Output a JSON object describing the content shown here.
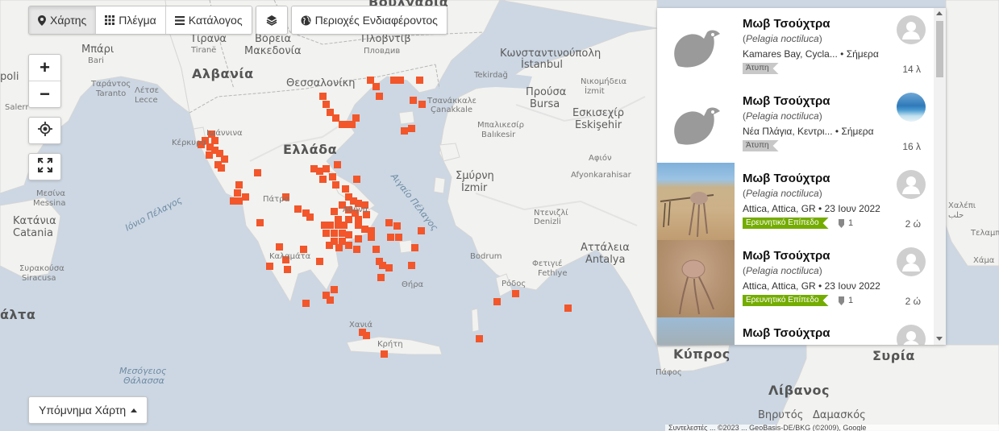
{
  "tabs": {
    "map": "Χάρτης",
    "grid": "Πλέγμα",
    "list": "Κατάλογος",
    "areas": "Περιοχές Ενδιαφέροντος"
  },
  "controls": {
    "zoom_in": "+",
    "zoom_out": "−"
  },
  "legend_label": "Υπόμνημα Χάρτη",
  "map_labels": {
    "bulgaria": "Βουλγαρία",
    "tirana": "Τίρανα",
    "tirane": "Tiranë",
    "albania": "Αλβανία",
    "north_macedonia_1": "Βόρεια",
    "north_macedonia_2": "Μακεδονία",
    "plovdiv_gr": "Πλοβντίβ",
    "plovdiv": "Пловдив",
    "istanbul_gr": "Κωνσταντινούπολη",
    "istanbul": "İstanbul",
    "bari_gr": "Μπάρι",
    "bari": "Bari",
    "polis": "poli",
    "taranto_gr": "Ταράντος",
    "taranto": "Taranto",
    "lecce_gr": "Λέτσε",
    "lecce": "Lecce",
    "salerno": "Salerr",
    "thessaloniki": "Θεσσαλονίκη",
    "tekirdag": "Tekirdağ",
    "nikomedia": "Νικομήδεια",
    "izmit": "İzmit",
    "prousa": "Προύσα",
    "bursa": "Bursa",
    "eskisehir_gr": "Εσκισεχίρ",
    "eskisehir": "Eskişehir",
    "canakkale_gr": "Τσανάκκαλε",
    "canakkale": "Çanakkale",
    "ioannina": "Ιωάννινα",
    "kerkyra": "Κέρκυρα",
    "ellada": "Ελλάδα",
    "mpalikesir": "Μπαλικεσίρ",
    "balikesir": "Balıkesir",
    "afion": "Αφιόν",
    "afyon": "Afyonkarahisar",
    "smyrni": "Σμύρνη",
    "izmir": "İzmir",
    "ionian_sea": "Ιόνιο Πέλαγος",
    "aegean_sea": "Αιγαίο Πέλαγος",
    "messina_gr": "Μεσίνα",
    "messina": "Messina",
    "katania_gr": "Κατάνια",
    "catania": "Catania",
    "patra": "Πάτρα",
    "athina": "Αθήνα",
    "kalamata": "Καλαμάτα",
    "syrakousa": "Συρακούσα",
    "siracusa": "Siracusa",
    "malta": "άλτα",
    "denizli_gr": "Ντενιζλί",
    "denizli": "Denizli",
    "attaleia": "Αττάλεια",
    "antalya": "Antalya",
    "bodrum": "Bodrum",
    "fethiye_gr": "Φετιγιέ",
    "fethiye": "Fethiye",
    "rodos": "Ρόδος",
    "thira": "Θήρα",
    "chania": "Χανιά",
    "kriti": "Κρήτη",
    "mediterranean_1": "Μεσόγειος",
    "mediterranean_2": "Θάλασσα",
    "kypros": "Κύπρος",
    "pafos": "Πάφος",
    "syria": "Συρία",
    "livanos": "Λίβανος",
    "beirut": "Βηρυτός",
    "damaskos": "Δαμασκός",
    "halep": "Χαλέπι",
    "halab": "حلب",
    "teleboos": "Τελαμπούς",
    "hama": "Χάμα"
  },
  "observations": [
    {
      "name": "Μωβ Τσούχτρα",
      "scientific": "Pelagia noctiluca",
      "place": "Kamares Bay, Cycla...",
      "date": "Σήμερα",
      "quality": "Άτυπη",
      "quality_type": "casual",
      "ids": "",
      "time": "14 λ",
      "photo": "placeholder",
      "avatar": "default"
    },
    {
      "name": "Μωβ Τσούχτρα",
      "scientific": "Pelagia noctiluca",
      "place": "Νέα Πλάγια, Κεντρι...",
      "date": "Σήμερα",
      "quality": "Άτυπη",
      "quality_type": "casual",
      "ids": "",
      "time": "16 λ",
      "photo": "placeholder",
      "avatar": "sea-photo"
    },
    {
      "name": "Μωβ Τσούχτρα",
      "scientific": "Pelagia noctiluca",
      "place": "Attica, Attica, GR",
      "date": "23 Ιουν 2022",
      "quality": "Ερευνητικό Επίπεδο",
      "quality_type": "research",
      "ids": "1",
      "time": "2 ώ",
      "photo": "beach-jellyfish-stick",
      "avatar": "default"
    },
    {
      "name": "Μωβ Τσούχτρα",
      "scientific": "Pelagia noctiluca",
      "place": "Attica, Attica, GR",
      "date": "23 Ιουν 2022",
      "quality": "Ερευνητικό Επίπεδο",
      "quality_type": "research",
      "ids": "1",
      "time": "2 ώ",
      "photo": "beach-jellyfish-sand",
      "avatar": "default"
    },
    {
      "name": "Μωβ Τσούχτρα",
      "scientific": "",
      "place": "",
      "date": "",
      "quality": "",
      "quality_type": "",
      "ids": "",
      "time": "",
      "photo": "",
      "avatar": "default"
    }
  ],
  "colors": {
    "observation_cell": "#f2562a",
    "research_badge": "#74ac00",
    "casual_badge": "#c8c8c8",
    "land": "#f2f2f0",
    "sea": "#ccd7e3"
  },
  "attribution": "Συντελεστές ... ©2023 ... GeoBasis-DE/BKG (©2009), Google"
}
